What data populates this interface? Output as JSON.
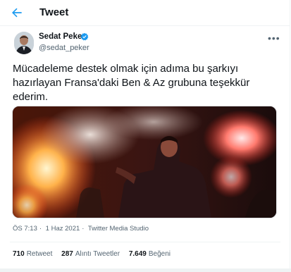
{
  "header": {
    "title": "Tweet"
  },
  "tweet": {
    "author_name": "Sedat Peker",
    "author_handle": "@sedat_peker",
    "text_lines": [
      "Mücadeleme destek olmak için  adıma bu şarkıyı",
      "hazırlayan Fransa'daki Ben & Az grubuna  teşekkür",
      "ederim."
    ],
    "time": "ÖS 7:13",
    "date": "1 Haz 2021",
    "source": "Twitter Media Studio",
    "separator": "·"
  },
  "stats": {
    "retweets_value": "710",
    "retweets_label": "Retweet",
    "quotes_value": "287",
    "quotes_label": "Alıntı Tweetler",
    "likes_value": "7.649",
    "likes_label": "Beğeni"
  },
  "colors": {
    "accent": "#1d9bf0",
    "secondary_text": "#536471",
    "divider": "#eff3f4"
  },
  "icons": {
    "back": "back-arrow-icon",
    "verified": "verified-badge-icon",
    "more": "more-options-icon"
  }
}
